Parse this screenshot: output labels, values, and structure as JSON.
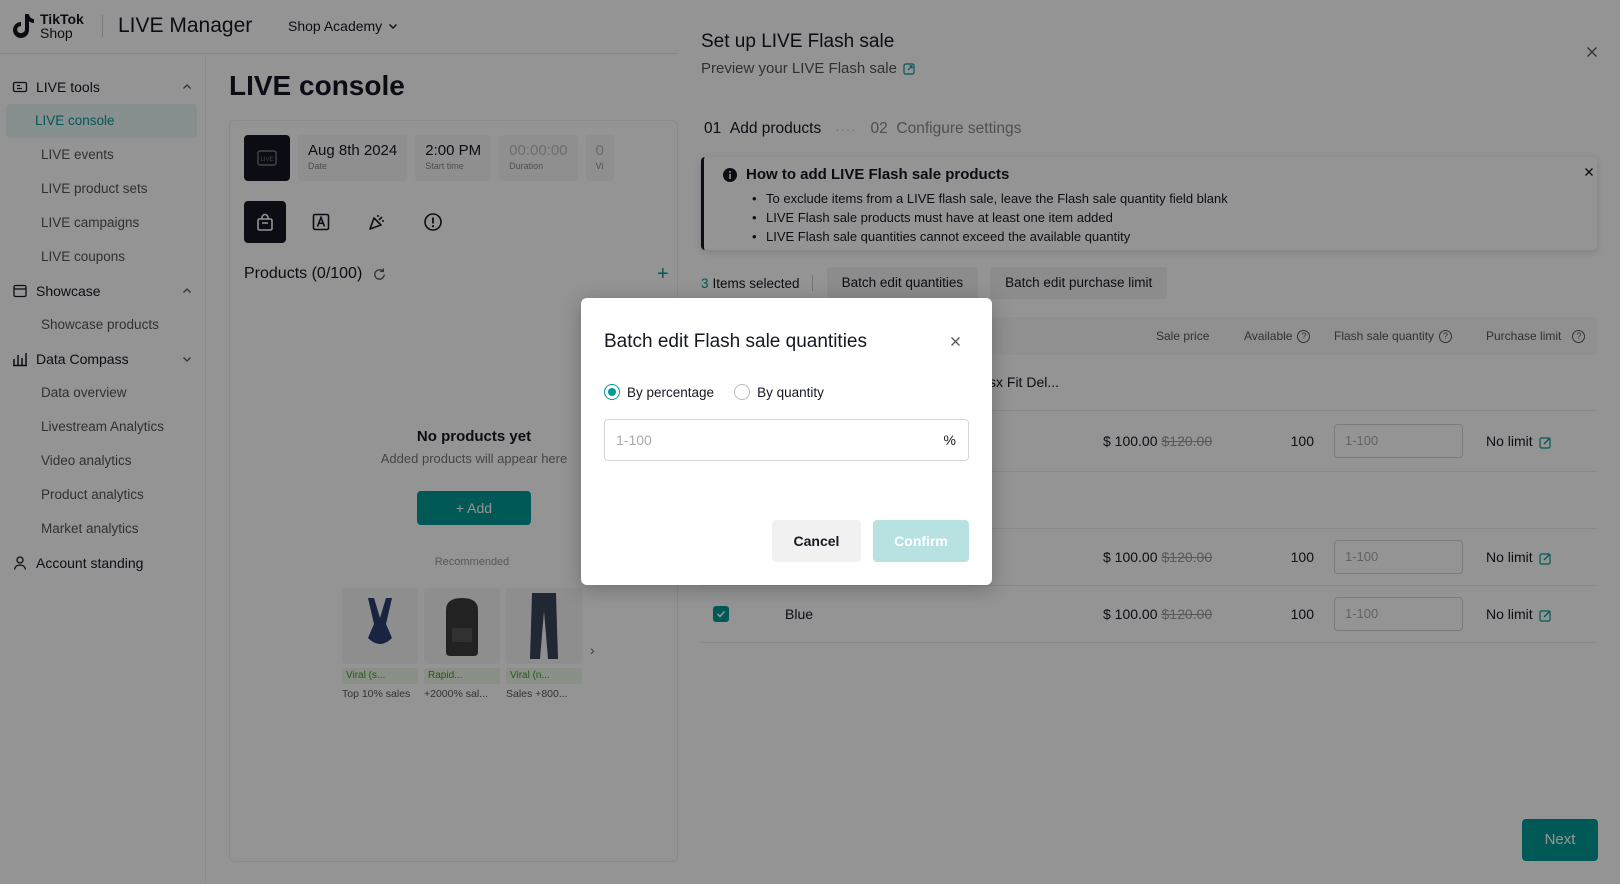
{
  "app": {
    "logo_line1": "TikTok",
    "logo_line2": "Shop",
    "title": "LIVE Manager",
    "shop_academy": "Shop Academy"
  },
  "sidebar": {
    "groups": [
      {
        "label": "LIVE tools",
        "icon": "live-tools-icon",
        "items": [
          "LIVE console",
          "LIVE events",
          "LIVE product sets",
          "LIVE campaigns",
          "LIVE coupons"
        ]
      },
      {
        "label": "Showcase",
        "icon": "showcase-icon",
        "items": [
          "Showcase products"
        ]
      },
      {
        "label": "Data Compass",
        "icon": "data-compass-icon",
        "items": [
          "Data overview",
          "Livestream Analytics",
          "Video analytics",
          "Product analytics",
          "Market analytics"
        ]
      }
    ],
    "account_standing": "Account standing"
  },
  "console": {
    "title": "LIVE console",
    "date_value": "Aug 8th 2024",
    "date_label": "Date",
    "start_value": "2:00 PM",
    "start_label": "Start time",
    "duration_value": "00:00:00",
    "duration_label": "Duration",
    "viewers_value": "0",
    "viewers_label": "Vi",
    "products_header": "Products (0/100)",
    "empty_title": "No products yet",
    "empty_sub": "Added products will appear here",
    "add_label": "+ Add",
    "recommended_label": "Recommended",
    "recommended": [
      {
        "badge": "Viral (s...",
        "stat": "Top 10% sales"
      },
      {
        "badge": "Rapid...",
        "stat": "+2000% sal..."
      },
      {
        "badge": "Viral (n...",
        "stat": "Sales +800..."
      }
    ]
  },
  "drawer": {
    "title": "Set up LIVE Flash sale",
    "preview_link": "Preview your LIVE Flash sale",
    "step1_num": "01",
    "step1_label": "Add products",
    "step2_num": "02",
    "step2_label": "Configure settings",
    "howto_title": "How to add LIVE Flash sale products",
    "howto_items": [
      "To exclude items from a LIVE flash sale, leave the Flash sale quantity field blank",
      "LIVE Flash sale products must have at least one item added",
      "LIVE Flash sale quantities cannot exceed the available quantity"
    ],
    "selected_count": "3",
    "selected_label": "Items selected",
    "batch_qty_btn": "Batch edit quantities",
    "batch_limit_btn": "Batch edit purchase limit",
    "columns": {
      "sale_price": "Sale price",
      "available": "Available",
      "flash_qty": "Flash sale quantity",
      "purchase_limit": "Purchase limit"
    },
    "product_name_partial": "sx Fit Del...",
    "rows": [
      {
        "variant": "",
        "price": "$ 100.00",
        "old_price": "$120.00",
        "available": "100",
        "qty_placeholder": "1-100",
        "limit": "No limit"
      },
      {
        "variant": "",
        "price": "$ 100.00",
        "old_price": "$120.00",
        "available": "100",
        "qty_placeholder": "1-100",
        "limit": "No limit"
      },
      {
        "variant": "Blue",
        "price": "$ 100.00",
        "old_price": "$120.00",
        "available": "100",
        "qty_placeholder": "1-100",
        "limit": "No limit"
      }
    ],
    "next_label": "Next"
  },
  "modal": {
    "title": "Batch edit Flash sale quantities",
    "option_percentage": "By percentage",
    "option_quantity": "By quantity",
    "selected_option": "By percentage",
    "input_placeholder": "1-100",
    "input_value": "",
    "input_suffix": "%",
    "cancel_label": "Cancel",
    "confirm_label": "Confirm"
  },
  "colors": {
    "accent": "#009995",
    "confirm_disabled": "#b8e2e1",
    "overlay": "rgba(0,0,0,0.42)"
  }
}
